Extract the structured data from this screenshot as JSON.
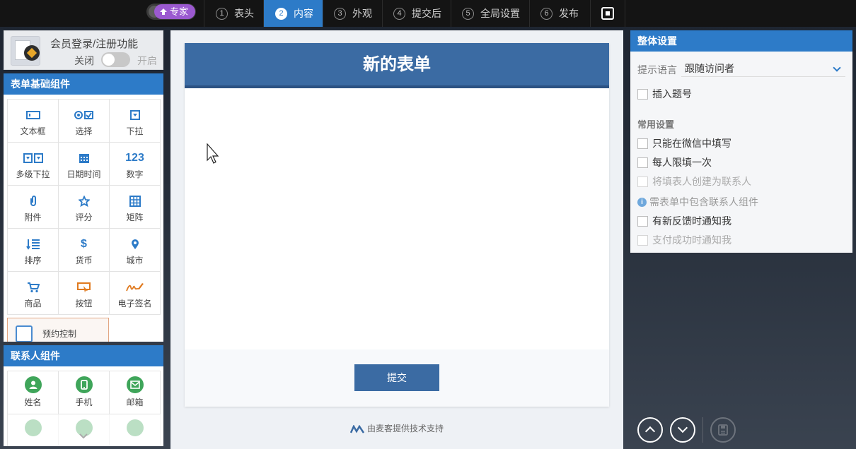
{
  "topbar": {
    "expert_label": "专家",
    "steps": [
      {
        "num": "1",
        "label": "表头"
      },
      {
        "num": "2",
        "label": "内容"
      },
      {
        "num": "3",
        "label": "外观"
      },
      {
        "num": "4",
        "label": "提交后"
      },
      {
        "num": "5",
        "label": "全局设置"
      },
      {
        "num": "6",
        "label": "发布"
      }
    ],
    "active_step": "内容"
  },
  "member": {
    "title": "会员登录/注册功能",
    "off_label": "关闭",
    "on_label": "开启",
    "enabled": false
  },
  "basic_components": {
    "title": "表单基础组件",
    "items": [
      {
        "label": "文本框",
        "icon": "textbox-icon"
      },
      {
        "label": "选择",
        "icon": "choice-icon"
      },
      {
        "label": "下拉",
        "icon": "dropdown-icon"
      },
      {
        "label": "多级下拉",
        "icon": "multilevel-dropdown-icon"
      },
      {
        "label": "日期时间",
        "icon": "calendar-icon"
      },
      {
        "label": "数字",
        "icon": "number-icon",
        "glyph": "123"
      },
      {
        "label": "附件",
        "icon": "paperclip-icon"
      },
      {
        "label": "评分",
        "icon": "star-icon"
      },
      {
        "label": "矩阵",
        "icon": "matrix-icon"
      },
      {
        "label": "排序",
        "icon": "sort-icon"
      },
      {
        "label": "货币",
        "icon": "currency-icon",
        "glyph": "$"
      },
      {
        "label": "城市",
        "icon": "location-pin-icon"
      },
      {
        "label": "商品",
        "icon": "cart-icon"
      },
      {
        "label": "按钮",
        "icon": "button-click-icon"
      },
      {
        "label": "电子签名",
        "icon": "signature-icon"
      }
    ],
    "reserve": {
      "label": "预约控制",
      "icon": "calendar-reserve-icon"
    }
  },
  "contact_components": {
    "title": "联系人组件",
    "items": [
      {
        "label": "姓名",
        "icon": "person-icon"
      },
      {
        "label": "手机",
        "icon": "phone-icon"
      },
      {
        "label": "邮箱",
        "icon": "mail-icon"
      }
    ]
  },
  "form": {
    "title": "新的表单",
    "submit_label": "提交",
    "powered_by": "由麦客提供技术支持"
  },
  "settings": {
    "title": "整体设置",
    "language_label": "提示语言",
    "language_value": "跟随访问者",
    "insert_number": "插入题号",
    "common_title": "常用设置",
    "options": [
      {
        "label": "只能在微信中填写",
        "disabled": false
      },
      {
        "label": "每人限填一次",
        "disabled": false
      },
      {
        "label": "将填表人创建为联系人",
        "disabled": true
      }
    ],
    "hint": "需表单中包含联系人组件",
    "options2": [
      {
        "label": "有新反馈时通知我",
        "disabled": false
      },
      {
        "label": "支付成功时通知我",
        "disabled": true
      }
    ]
  },
  "colors": {
    "accent": "#2d7bc8",
    "form_header": "#3b6ba3",
    "expert": "#9b59d0",
    "contact_green": "#3fa55a"
  }
}
